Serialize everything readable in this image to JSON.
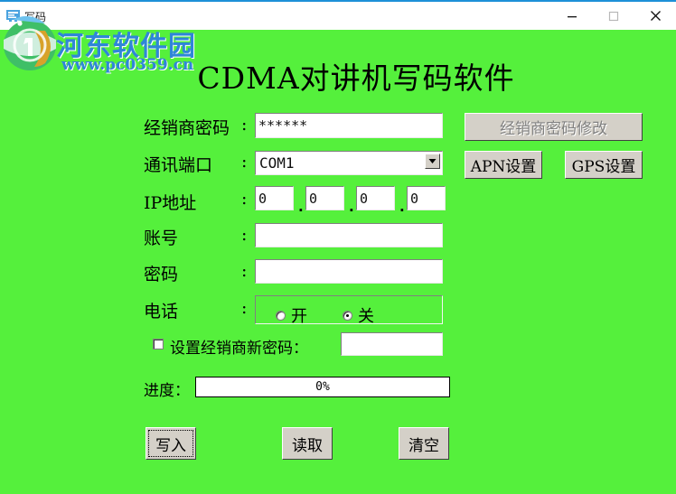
{
  "window": {
    "title": "写码",
    "icon": "app-window-icon",
    "controls": {
      "minimize": "minimize-icon",
      "maximize": "maximize-icon",
      "close": "close-icon"
    }
  },
  "watermark": {
    "site_name": "河东软件园",
    "site_url": "www.pc0359.cn",
    "logo": "globe-logo"
  },
  "app": {
    "heading": "CDMA对讲机写码软件"
  },
  "form": {
    "dealer_password": {
      "label": "经销商密码",
      "colon": ":",
      "value": "******"
    },
    "com_port": {
      "label": "通讯端口",
      "colon": ":",
      "value": "COM1",
      "options": [
        "COM1"
      ],
      "arrow_icon": "chevron-down-icon"
    },
    "ip_address": {
      "label": "IP地址",
      "colon": ":",
      "octets": [
        "0",
        "0",
        "0",
        "0"
      ],
      "separator": "."
    },
    "account": {
      "label": "账号",
      "colon": ":",
      "value": ""
    },
    "password": {
      "label": "密码",
      "colon": ":",
      "value": ""
    },
    "phone": {
      "label": "电话",
      "colon": ":",
      "options": [
        {
          "label": "开",
          "selected": false
        },
        {
          "label": "关",
          "selected": true
        }
      ]
    },
    "new_dealer_password": {
      "checkbox_label": "设置经销商新密码：",
      "checked": false,
      "value": ""
    },
    "progress": {
      "label": "进度：",
      "percent_text": "0%",
      "percent": 0
    }
  },
  "side_buttons": {
    "change_dealer_password": {
      "label": "经销商密码修改",
      "disabled": true
    },
    "apn_settings": {
      "label": "APN设置",
      "disabled": false
    },
    "gps_settings": {
      "label": "GPS设置",
      "disabled": false
    }
  },
  "bottom_buttons": {
    "write": {
      "label": "写入",
      "focused": true
    },
    "read": {
      "label": "读取",
      "focused": false
    },
    "clear": {
      "label": "清空",
      "focused": false
    }
  },
  "colors": {
    "background": "#55f03c",
    "titlebar": "#ffffff",
    "titlebar_accent": "#1e90d8",
    "watermark": "#2f86d8",
    "button_face": "#d4d0c8",
    "field": "#ffffff"
  }
}
